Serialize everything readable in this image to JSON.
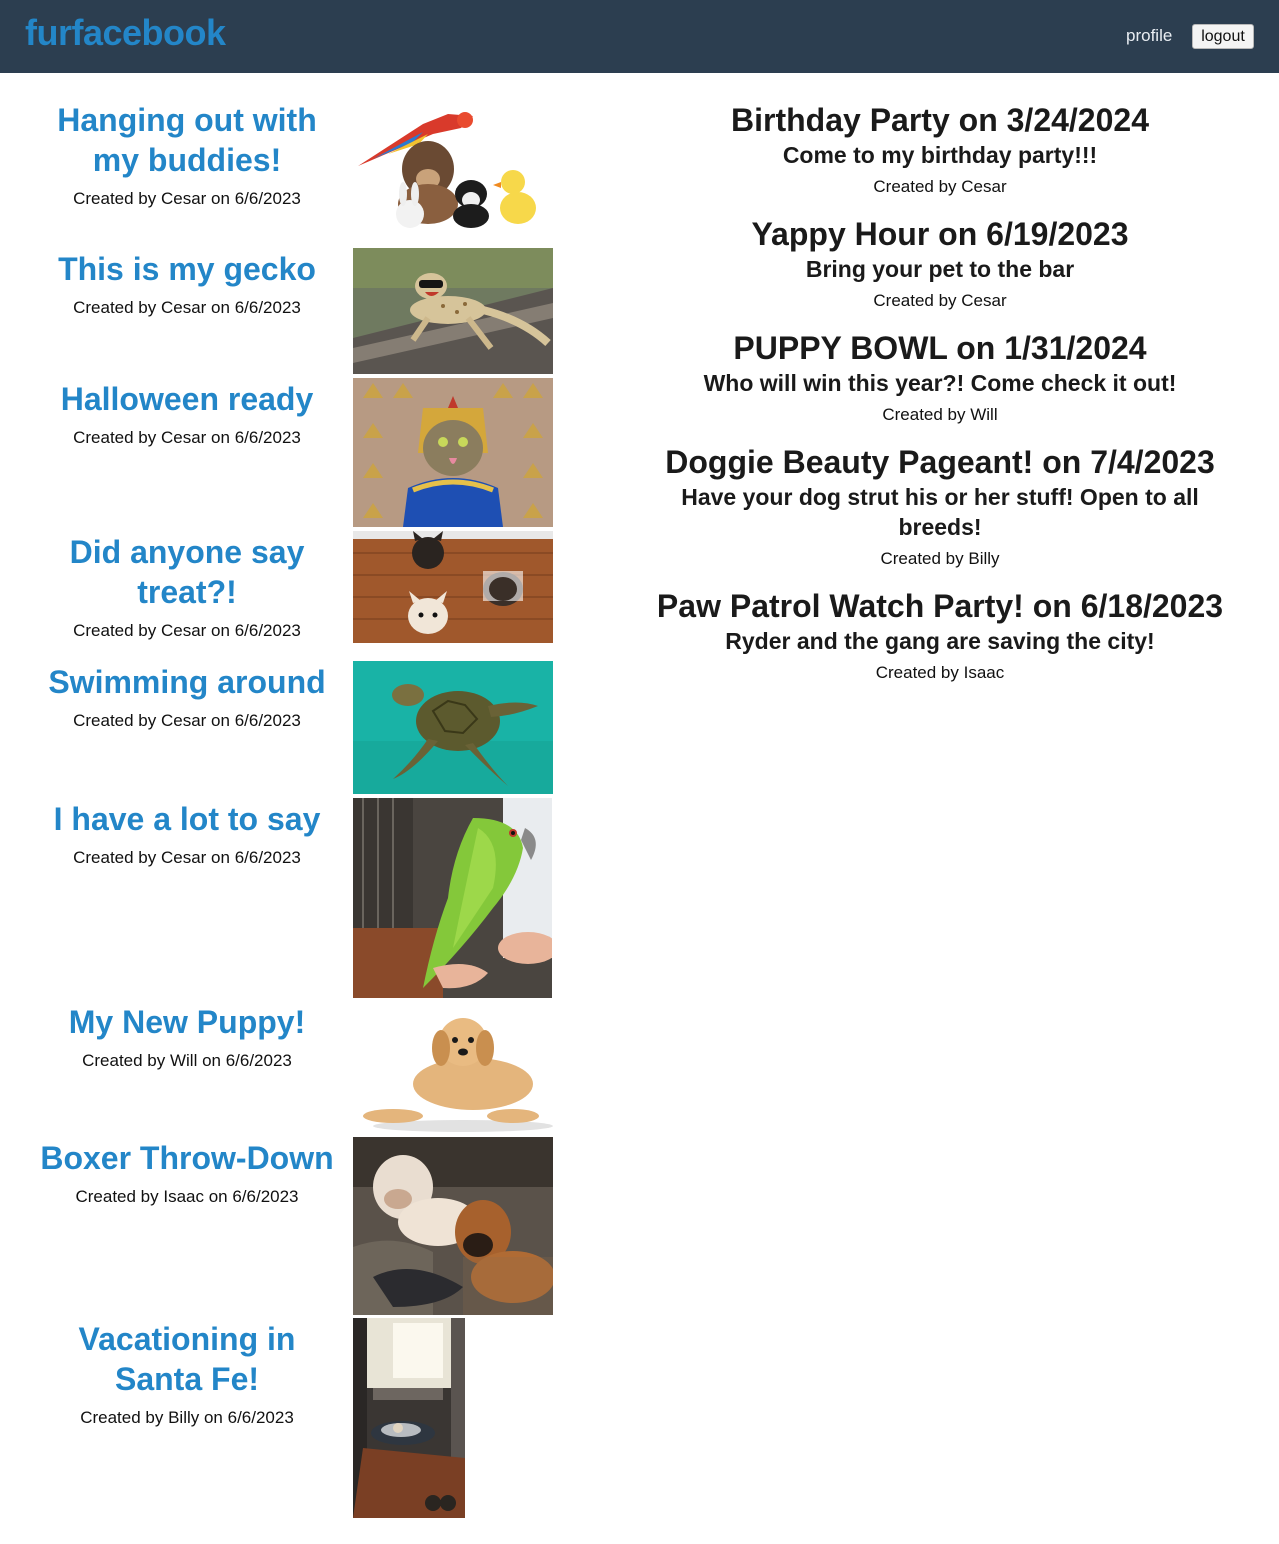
{
  "nav": {
    "brand": "furfacebook",
    "profile": "profile",
    "logout": "logout"
  },
  "colors": {
    "navbar": "#2c3e50",
    "accent": "#2386c8"
  },
  "posts": [
    {
      "title": "Hanging out with my buddies!",
      "meta": "Created by Cesar on 6/6/2023",
      "image": "pets-group-photo"
    },
    {
      "title": "This is my gecko",
      "meta": "Created by Cesar on 6/6/2023",
      "image": "gecko-photo"
    },
    {
      "title": "Halloween ready",
      "meta": "Created by Cesar on 6/6/2023",
      "image": "cat-costume-photo"
    },
    {
      "title": "Did anyone say treat?!",
      "meta": "Created by Cesar on 6/6/2023",
      "image": "french-bulldogs-photo"
    },
    {
      "title": "Swimming around",
      "meta": "Created by Cesar on 6/6/2023",
      "image": "sea-turtle-photo"
    },
    {
      "title": "I have a lot to say",
      "meta": "Created by Cesar on 6/6/2023",
      "image": "green-parrot-photo"
    },
    {
      "title": "My New Puppy!",
      "meta": "Created by Will on 6/6/2023",
      "image": "golden-puppy-photo"
    },
    {
      "title": "Boxer Throw-Down",
      "meta": "Created by Isaac on 6/6/2023",
      "image": "boxer-dogs-photo"
    },
    {
      "title": "Vacationing in Santa Fe!",
      "meta": "Created by Billy on 6/6/2023",
      "image": "dog-bed-photo"
    }
  ],
  "events": [
    {
      "title": "Birthday Party on 3/24/2024",
      "description": "Come to my birthday party!!!",
      "meta": "Created by Cesar"
    },
    {
      "title": "Yappy Hour on 6/19/2023",
      "description": "Bring your pet to the bar",
      "meta": "Created by Cesar"
    },
    {
      "title": "PUPPY BOWL on 1/31/2024",
      "description": "Who will win this year?! Come check it out!",
      "meta": "Created by Will"
    },
    {
      "title": "Doggie Beauty Pageant! on 7/4/2023",
      "description": "Have your dog strut his or her stuff! Open to all breeds!",
      "meta": "Created by Billy"
    },
    {
      "title": "Paw Patrol Watch Party! on 6/18/2023",
      "description": "Ryder and the gang are saving the city!",
      "meta": "Created by Isaac"
    }
  ]
}
